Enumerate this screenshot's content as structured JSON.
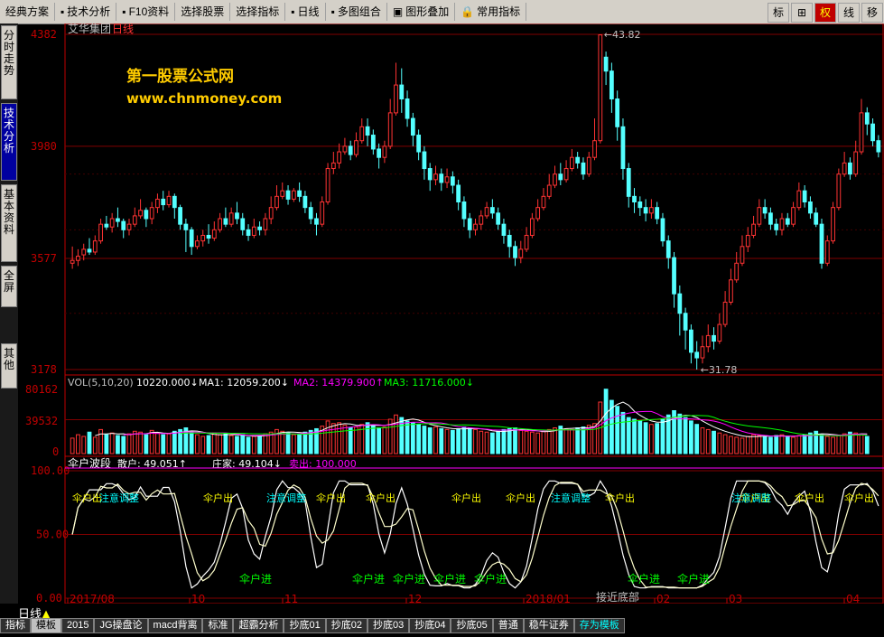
{
  "toolbar": {
    "items": [
      "经典方案",
      "技术分析",
      "F10资料",
      "选择股票",
      "选择指标",
      "日线",
      "多图组合",
      "图形叠加",
      "常用指标"
    ],
    "right_buttons": [
      "标",
      "⊞",
      "权",
      "线",
      "移"
    ],
    "active_right": 2
  },
  "left_tabs": [
    "分时走势",
    "技术分析",
    "基本资料",
    "全屏",
    "其他"
  ],
  "active_left": 1,
  "main": {
    "stock": "艾华集团",
    "period": "日线",
    "price_labels": [
      "4382",
      "3980",
      "3577",
      "3178"
    ],
    "price_values": [
      4382,
      3980,
      3577,
      3178
    ],
    "high_note": "43.82",
    "low_note": "31.78",
    "watermark_cn": "第一股票公式网",
    "watermark_url": "www.chnmoney.com"
  },
  "vol": {
    "header": "VOL(5,10,20)",
    "vol_val": "10220.000↓",
    "ma1": "MA1: 12059.200↓",
    "ma2": "MA2: 14379.900↑",
    "ma3": "MA3: 11716.000↓",
    "labels": [
      "80162",
      "39532",
      "0"
    ]
  },
  "ind": {
    "name": "伞户波段",
    "sanhu": "散户: 49.051↑",
    "zhuangjia": "庄家: 49.104↓",
    "maichu": "卖出: 100.000",
    "labels": [
      "100.00",
      "50.00",
      "0.00"
    ],
    "out_label": "伞户出",
    "in_label": "伞户进",
    "adjust_label": "注意调整",
    "bottom_label": "接近底部"
  },
  "x_axis": [
    "2017/08",
    "10",
    "11",
    "12",
    "2018/01",
    "02",
    "03",
    "04"
  ],
  "bottom": {
    "period_label": "日线",
    "tabs": [
      "指标",
      "模板",
      "2015",
      "JG操盘论",
      "macd背离",
      "标准",
      "超霸分析",
      "抄底01",
      "抄底02",
      "抄底03",
      "抄底04",
      "抄底05",
      "普通",
      "稳牛证券",
      "存为模板"
    ],
    "active_tab": 1
  },
  "colors": {
    "up": "#ff3333",
    "down": "#54ffff",
    "grid": "#800000",
    "axis": "#c00000",
    "text": "#c0c0c0"
  },
  "chart_data": {
    "type": "candlestick",
    "title": "",
    "ylim": [
      3178,
      4382
    ],
    "candles": [
      [
        3560,
        3570,
        3620,
        3540
      ],
      [
        3570,
        3585,
        3610,
        3550
      ],
      [
        3590,
        3610,
        3630,
        3570
      ],
      [
        3610,
        3600,
        3650,
        3590
      ],
      [
        3600,
        3640,
        3660,
        3590
      ],
      [
        3640,
        3700,
        3720,
        3630
      ],
      [
        3700,
        3690,
        3730,
        3680
      ],
      [
        3690,
        3720,
        3740,
        3670
      ],
      [
        3720,
        3710,
        3760,
        3690
      ],
      [
        3710,
        3680,
        3720,
        3650
      ],
      [
        3680,
        3700,
        3720,
        3660
      ],
      [
        3700,
        3730,
        3760,
        3690
      ],
      [
        3730,
        3750,
        3790,
        3720
      ],
      [
        3750,
        3720,
        3760,
        3690
      ],
      [
        3720,
        3760,
        3780,
        3700
      ],
      [
        3760,
        3790,
        3810,
        3740
      ],
      [
        3790,
        3770,
        3820,
        3750
      ],
      [
        3770,
        3800,
        3820,
        3760
      ],
      [
        3800,
        3760,
        3810,
        3720
      ],
      [
        3760,
        3700,
        3770,
        3680
      ],
      [
        3700,
        3680,
        3720,
        3600
      ],
      [
        3680,
        3620,
        3690,
        3590
      ],
      [
        3620,
        3640,
        3660,
        3610
      ],
      [
        3640,
        3660,
        3680,
        3620
      ],
      [
        3660,
        3650,
        3700,
        3630
      ],
      [
        3650,
        3680,
        3710,
        3640
      ],
      [
        3680,
        3720,
        3740,
        3670
      ],
      [
        3720,
        3700,
        3760,
        3690
      ],
      [
        3700,
        3740,
        3760,
        3690
      ],
      [
        3740,
        3720,
        3780,
        3700
      ],
      [
        3720,
        3680,
        3740,
        3660
      ],
      [
        3680,
        3660,
        3700,
        3640
      ],
      [
        3660,
        3690,
        3720,
        3650
      ],
      [
        3690,
        3680,
        3710,
        3660
      ],
      [
        3680,
        3720,
        3740,
        3660
      ],
      [
        3720,
        3760,
        3800,
        3700
      ],
      [
        3760,
        3800,
        3840,
        3750
      ],
      [
        3800,
        3820,
        3850,
        3790
      ],
      [
        3820,
        3790,
        3840,
        3770
      ],
      [
        3790,
        3820,
        3830,
        3780
      ],
      [
        3820,
        3800,
        3850,
        3780
      ],
      [
        3800,
        3760,
        3820,
        3740
      ],
      [
        3760,
        3720,
        3780,
        3700
      ],
      [
        3720,
        3700,
        3740,
        3660
      ],
      [
        3700,
        3780,
        3800,
        3690
      ],
      [
        3780,
        3900,
        3920,
        3770
      ],
      [
        3900,
        3920,
        3960,
        3880
      ],
      [
        3920,
        3960,
        3990,
        3900
      ],
      [
        3960,
        3980,
        4010,
        3950
      ],
      [
        3980,
        3950,
        4000,
        3930
      ],
      [
        3950,
        4000,
        4030,
        3940
      ],
      [
        4000,
        4050,
        4080,
        3990
      ],
      [
        4050,
        4020,
        4080,
        3980
      ],
      [
        4020,
        3970,
        4040,
        3950
      ],
      [
        3970,
        3940,
        3990,
        3900
      ],
      [
        3940,
        3980,
        4000,
        3920
      ],
      [
        3980,
        4100,
        4150,
        3970
      ],
      [
        4100,
        4200,
        4280,
        4090
      ],
      [
        4200,
        4150,
        4260,
        4100
      ],
      [
        4150,
        4080,
        4180,
        4050
      ],
      [
        4080,
        4020,
        4100,
        3980
      ],
      [
        4020,
        3960,
        4040,
        3930
      ],
      [
        3960,
        3900,
        3980,
        3860
      ],
      [
        3900,
        3860,
        3920,
        3820
      ],
      [
        3860,
        3880,
        3910,
        3840
      ],
      [
        3880,
        3850,
        3900,
        3820
      ],
      [
        3850,
        3870,
        3900,
        3830
      ],
      [
        3870,
        3840,
        3890,
        3810
      ],
      [
        3840,
        3780,
        3860,
        3750
      ],
      [
        3780,
        3720,
        3800,
        3690
      ],
      [
        3720,
        3680,
        3740,
        3650
      ],
      [
        3680,
        3700,
        3720,
        3660
      ],
      [
        3700,
        3730,
        3750,
        3680
      ],
      [
        3730,
        3760,
        3780,
        3720
      ],
      [
        3760,
        3740,
        3790,
        3720
      ],
      [
        3740,
        3700,
        3760,
        3680
      ],
      [
        3700,
        3660,
        3720,
        3630
      ],
      [
        3660,
        3620,
        3680,
        3580
      ],
      [
        3620,
        3580,
        3640,
        3550
      ],
      [
        3580,
        3610,
        3640,
        3560
      ],
      [
        3610,
        3660,
        3690,
        3600
      ],
      [
        3660,
        3720,
        3740,
        3650
      ],
      [
        3720,
        3760,
        3790,
        3710
      ],
      [
        3760,
        3800,
        3830,
        3750
      ],
      [
        3800,
        3840,
        3880,
        3790
      ],
      [
        3840,
        3880,
        3910,
        3830
      ],
      [
        3880,
        3860,
        3920,
        3840
      ],
      [
        3860,
        3900,
        3930,
        3850
      ],
      [
        3900,
        3940,
        3970,
        3890
      ],
      [
        3940,
        3920,
        3960,
        3900
      ],
      [
        3920,
        3880,
        3940,
        3860
      ],
      [
        3880,
        3940,
        3960,
        3870
      ],
      [
        3940,
        4000,
        4080,
        3930
      ],
      [
        4000,
        4380,
        4382,
        3990
      ],
      [
        4300,
        4250,
        4320,
        4200
      ],
      [
        4250,
        4150,
        4280,
        4100
      ],
      [
        4150,
        4050,
        4180,
        4000
      ],
      [
        4050,
        3900,
        4080,
        3860
      ],
      [
        3900,
        3800,
        3920,
        3760
      ],
      [
        3800,
        3780,
        3830,
        3740
      ],
      [
        3780,
        3760,
        3800,
        3730
      ],
      [
        3760,
        3740,
        3790,
        3710
      ],
      [
        3740,
        3760,
        3790,
        3720
      ],
      [
        3760,
        3720,
        3780,
        3700
      ],
      [
        3720,
        3640,
        3740,
        3620
      ],
      [
        3640,
        3580,
        3660,
        3540
      ],
      [
        3580,
        3450,
        3600,
        3400
      ],
      [
        3450,
        3380,
        3480,
        3300
      ],
      [
        3380,
        3320,
        3400,
        3250
      ],
      [
        3320,
        3240,
        3340,
        3200
      ],
      [
        3240,
        3220,
        3280,
        3178
      ],
      [
        3220,
        3260,
        3300,
        3200
      ],
      [
        3260,
        3300,
        3340,
        3240
      ],
      [
        3300,
        3280,
        3330,
        3250
      ],
      [
        3280,
        3340,
        3380,
        3270
      ],
      [
        3340,
        3420,
        3460,
        3330
      ],
      [
        3420,
        3500,
        3540,
        3410
      ],
      [
        3500,
        3560,
        3600,
        3490
      ],
      [
        3560,
        3620,
        3660,
        3550
      ],
      [
        3620,
        3660,
        3690,
        3600
      ],
      [
        3660,
        3700,
        3730,
        3650
      ],
      [
        3700,
        3760,
        3790,
        3690
      ],
      [
        3760,
        3740,
        3790,
        3720
      ],
      [
        3740,
        3700,
        3760,
        3680
      ],
      [
        3700,
        3680,
        3720,
        3660
      ],
      [
        3680,
        3720,
        3740,
        3660
      ],
      [
        3720,
        3700,
        3740,
        3690
      ],
      [
        3700,
        3760,
        3780,
        3690
      ],
      [
        3760,
        3820,
        3850,
        3750
      ],
      [
        3820,
        3780,
        3840,
        3760
      ],
      [
        3780,
        3740,
        3800,
        3720
      ],
      [
        3740,
        3700,
        3760,
        3690
      ],
      [
        3700,
        3560,
        3720,
        3540
      ],
      [
        3560,
        3640,
        3660,
        3550
      ],
      [
        3640,
        3760,
        3780,
        3630
      ],
      [
        3760,
        3880,
        3900,
        3750
      ],
      [
        3880,
        3920,
        3960,
        3870
      ],
      [
        3920,
        3880,
        3940,
        3860
      ],
      [
        3880,
        3960,
        4000,
        3870
      ],
      [
        3960,
        4100,
        4150,
        3950
      ],
      [
        4100,
        4060,
        4120,
        4020
      ],
      [
        4060,
        4000,
        4080,
        3980
      ],
      [
        4000,
        3960,
        4020,
        3940
      ]
    ],
    "volume": [
      18,
      22,
      20,
      25,
      19,
      28,
      22,
      24,
      21,
      20,
      23,
      26,
      25,
      22,
      27,
      24,
      22,
      23,
      26,
      28,
      30,
      25,
      22,
      20,
      21,
      24,
      22,
      23,
      21,
      20,
      22,
      19,
      20,
      21,
      23,
      25,
      28,
      26,
      24,
      22,
      23,
      25,
      27,
      29,
      32,
      38,
      35,
      36,
      33,
      30,
      31,
      34,
      36,
      33,
      30,
      31,
      40,
      45,
      42,
      38,
      36,
      34,
      32,
      30,
      31,
      29,
      28,
      27,
      29,
      31,
      30,
      28,
      26,
      25,
      24,
      26,
      28,
      29,
      30,
      27,
      26,
      25,
      24,
      26,
      28,
      30,
      32,
      29,
      28,
      30,
      31,
      33,
      35,
      60,
      75,
      62,
      55,
      48,
      42,
      40,
      38,
      36,
      34,
      35,
      40,
      45,
      50,
      46,
      42,
      38,
      34,
      30,
      28,
      26,
      24,
      22,
      20,
      19,
      18,
      20,
      22,
      21,
      20,
      19,
      21,
      22,
      20,
      19,
      21,
      22,
      24,
      26,
      22,
      20,
      19,
      21,
      23,
      25,
      24,
      22,
      20
    ]
  }
}
